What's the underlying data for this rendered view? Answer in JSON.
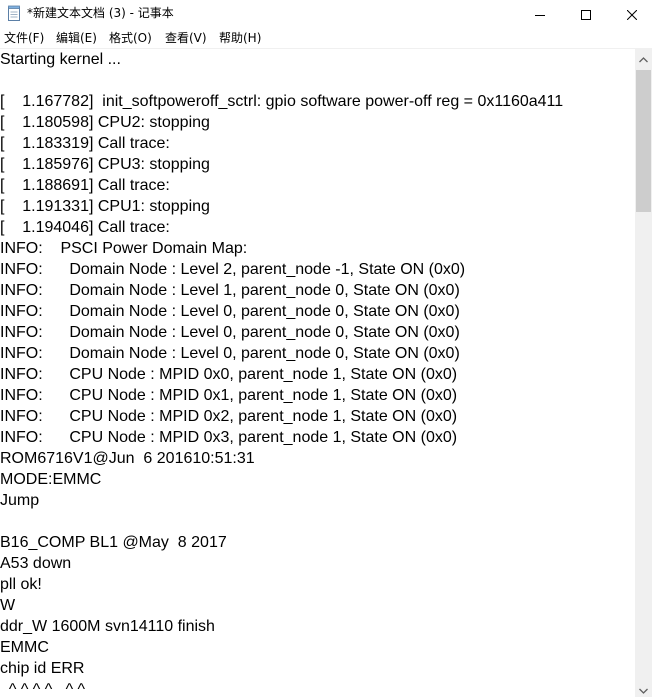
{
  "window": {
    "title": "*新建文本文档 (3) - 记事本",
    "icons": {
      "app": "notepad-icon",
      "minimize": "minimize-icon",
      "maximize": "maximize-icon",
      "close": "close-icon"
    }
  },
  "menu": {
    "items": [
      {
        "label": "文件(F)"
      },
      {
        "label": "编辑(E)"
      },
      {
        "label": "格式(O)"
      },
      {
        "label": "查看(V)"
      },
      {
        "label": "帮助(H)"
      }
    ]
  },
  "editor": {
    "lines": [
      "Starting kernel ...",
      "",
      "[    1.167782]  init_softpoweroff_sctrl: gpio software power-off reg = 0x1160a411",
      "[    1.180598] CPU2: stopping",
      "[    1.183319] Call trace:",
      "[    1.185976] CPU3: stopping",
      "[    1.188691] Call trace:",
      "[    1.191331] CPU1: stopping",
      "[    1.194046] Call trace:",
      "INFO:    PSCI Power Domain Map:",
      "INFO:      Domain Node : Level 2, parent_node -1, State ON (0x0)",
      "INFO:      Domain Node : Level 1, parent_node 0, State ON (0x0)",
      "INFO:      Domain Node : Level 0, parent_node 0, State ON (0x0)",
      "INFO:      Domain Node : Level 0, parent_node 0, State ON (0x0)",
      "INFO:      Domain Node : Level 0, parent_node 0, State ON (0x0)",
      "INFO:      CPU Node : MPID 0x0, parent_node 1, State ON (0x0)",
      "INFO:      CPU Node : MPID 0x1, parent_node 1, State ON (0x0)",
      "INFO:      CPU Node : MPID 0x2, parent_node 1, State ON (0x0)",
      "INFO:      CPU Node : MPID 0x3, parent_node 1, State ON (0x0)",
      "ROM6716V1@Jun  6 201610:51:31",
      "MODE:EMMC",
      "Jump",
      "",
      "B16_COMP BL1 @May  8 2017",
      "A53 down",
      "pll ok!",
      "W",
      "ddr_W 1600M svn14110 finish",
      "EMMC",
      "chip id ERR",
      "  ^ ^ ^ ^   ^ ^"
    ]
  },
  "scrollbar": {
    "up_icon": "scroll-up-arrow-icon",
    "down_icon": "scroll-down-arrow-icon"
  }
}
